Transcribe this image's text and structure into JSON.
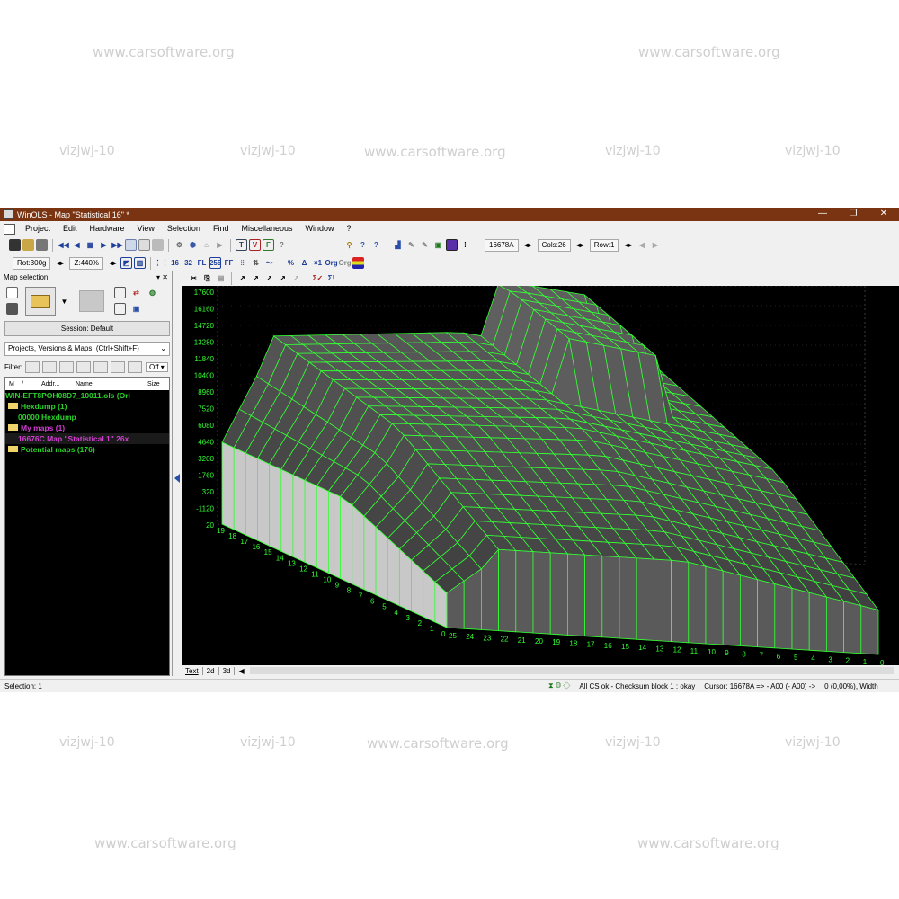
{
  "watermarks": {
    "site": "www.carsoftware.org",
    "code": "vizjwj-10"
  },
  "window": {
    "title": "WinOLS - Map \"Statistical 16\" *",
    "controls": [
      "—",
      "❐",
      "✕"
    ]
  },
  "menu": [
    "Project",
    "Edit",
    "Hardware",
    "View",
    "Selection",
    "Find",
    "Miscellaneous",
    "Window",
    "?"
  ],
  "toolbar": {
    "address": "16678A",
    "cols": "Cols:26",
    "row": "Row:1",
    "rot": "Rot:300g",
    "zoom": "Z:440%",
    "help_q": "?"
  },
  "left_panel": {
    "title": "Map selection",
    "session_button": "Session: Default",
    "combo": "Projects, Versions & Maps: (Ctrl+Shift+F)",
    "filter_label": "Filter:",
    "filter_value": "Off",
    "columns": [
      "M",
      "/",
      "Addr...",
      "Name",
      "Size"
    ],
    "items": [
      {
        "text": "WIN-EFT8POH08D7_10011.ols (Ori",
        "color": "#2bd02b"
      },
      {
        "text": "Hexdump (1)",
        "color": "#2bd02b",
        "folder": true
      },
      {
        "text": "00000        Hexdump",
        "color": "#2bd02b",
        "indent": true
      },
      {
        "text": "My maps (1)",
        "color": "#d33fd3",
        "folder": true
      },
      {
        "text": "16676C     Map \"Statistical 1\" 26x",
        "color": "#d33fd3",
        "indent": true,
        "selected": true
      },
      {
        "text": "Potential maps (176)",
        "color": "#2bd02b",
        "folder": true
      }
    ]
  },
  "tabs": [
    "Text",
    "2d",
    "3d"
  ],
  "status": {
    "selection": "Selection: 1",
    "checksum": "All CS ok - Checksum block 1 : okay",
    "cursor": "Cursor: 16678A => - A00 (- A00) ->",
    "value": "0 (0,00%), Width"
  },
  "chart_data": {
    "type": "surface",
    "grid_color": "#33ff33",
    "background": "#000000",
    "z_ticks": [
      "17600",
      "16160",
      "14720",
      "13280",
      "11840",
      "10400",
      "8960",
      "7520",
      "6080",
      "4640",
      "3200",
      "1760",
      "320",
      "-1120",
      "20"
    ],
    "x_ticks": [
      "19",
      "18",
      "17",
      "16",
      "15",
      "14",
      "13",
      "12",
      "11",
      "10",
      "9",
      "8",
      "7",
      "6",
      "5",
      "4",
      "3",
      "2",
      "1",
      "0"
    ],
    "y_ticks": [
      "25",
      "24",
      "23",
      "22",
      "21",
      "20",
      "19",
      "18",
      "17",
      "16",
      "15",
      "14",
      "13",
      "12",
      "11",
      "10",
      "9",
      "8",
      "7",
      "6",
      "5",
      "4",
      "3",
      "2",
      "1",
      "0"
    ]
  }
}
